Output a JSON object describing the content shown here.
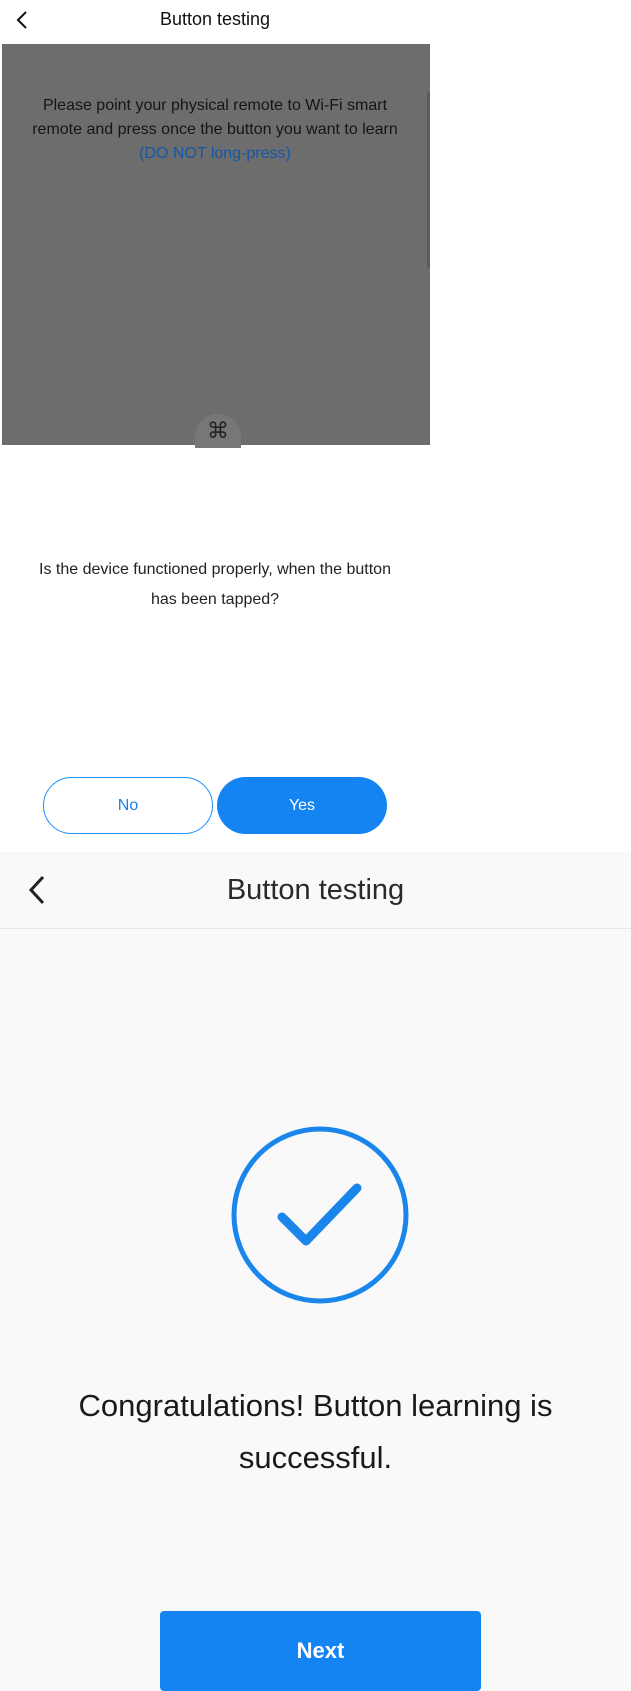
{
  "top_screen": {
    "header": {
      "title": "Button testing"
    },
    "instruction": {
      "text": "Please point your physical remote to Wi-Fi smart remote and press once the button you want to learn ",
      "highlight": "(DO NOT long-press)"
    },
    "center_icon": "⌘",
    "question": "Is the device functioned properly, when the button has been tapped?",
    "buttons": {
      "no": "No",
      "yes": "Yes"
    }
  },
  "bottom_screen": {
    "header": {
      "title": "Button testing"
    },
    "message": "Congratulations! Button learning is successful.",
    "next_button": "Next"
  },
  "colors": {
    "accent": "#1384f2",
    "overlay": "#6d6d6d",
    "highlight_text": "#1457a8",
    "background_bottom": "#f9f9f9"
  },
  "icons": {
    "back": "chevron-left-icon",
    "command": "command-icon",
    "success": "check-circle-icon"
  }
}
